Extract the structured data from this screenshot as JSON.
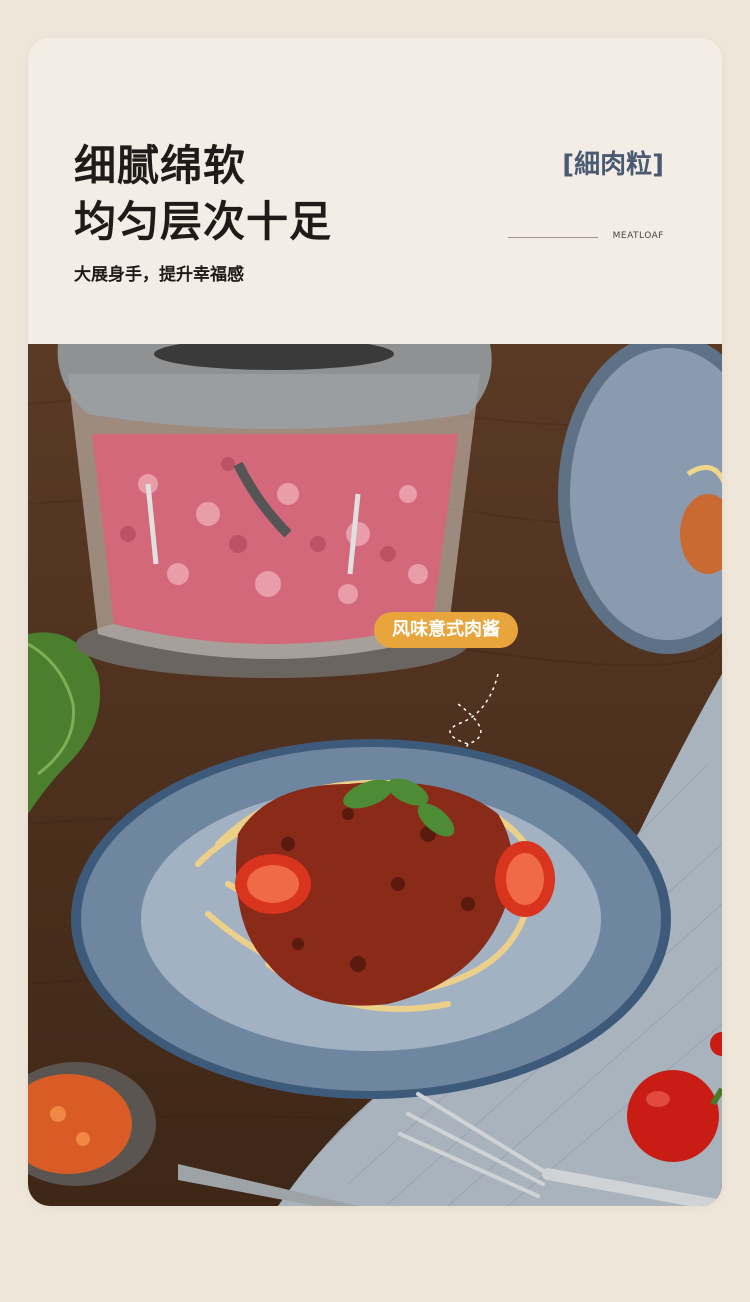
{
  "header": {
    "headline_line1": "细腻绵软",
    "headline_line2": "均匀层次十足",
    "subline": "大展身手，提升幸福感",
    "tag": "[細肉粒]",
    "tag_sub": "MEATLOAF"
  },
  "photo": {
    "callout": "风味意式肉酱"
  }
}
